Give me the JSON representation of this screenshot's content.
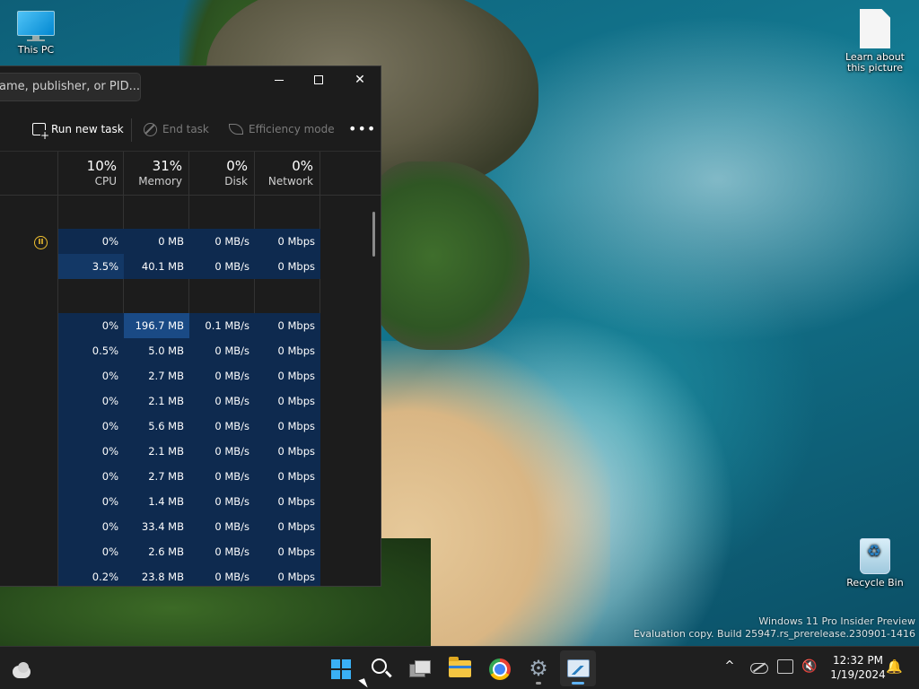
{
  "desktop": {
    "icons": [
      {
        "label": "This PC"
      },
      {
        "label": "Learn about this picture"
      },
      {
        "label": "Recycle Bin"
      }
    ],
    "watermark": {
      "line1": "Windows 11 Pro Insider Preview",
      "line2": "Evaluation copy. Build 25947.rs_prerelease.230901-1416"
    }
  },
  "task_manager": {
    "search_placeholder": "ame, publisher, or PID...",
    "toolbar": {
      "run_new_task": "Run new task",
      "end_task": "End task",
      "efficiency_mode": "Efficiency mode",
      "more": "•••"
    },
    "columns": [
      {
        "pct": "10%",
        "label": "CPU"
      },
      {
        "pct": "31%",
        "label": "Memory"
      },
      {
        "pct": "0%",
        "label": "Disk"
      },
      {
        "pct": "0%",
        "label": "Network"
      }
    ],
    "rows": [
      {
        "cpu": "0%",
        "mem": "0 MB",
        "disk": "0 MB/s",
        "net": "0 Mbps"
      },
      {
        "cpu": "3.5%",
        "mem": "40.1 MB",
        "disk": "0 MB/s",
        "net": "0 Mbps"
      },
      {
        "cpu": "0%",
        "mem": "196.7 MB",
        "disk": "0.1 MB/s",
        "net": "0 Mbps"
      },
      {
        "cpu": "0.5%",
        "mem": "5.0 MB",
        "disk": "0 MB/s",
        "net": "0 Mbps"
      },
      {
        "cpu": "0%",
        "mem": "2.7 MB",
        "disk": "0 MB/s",
        "net": "0 Mbps"
      },
      {
        "cpu": "0%",
        "mem": "2.1 MB",
        "disk": "0 MB/s",
        "net": "0 Mbps"
      },
      {
        "cpu": "0%",
        "mem": "5.6 MB",
        "disk": "0 MB/s",
        "net": "0 Mbps"
      },
      {
        "cpu": "0%",
        "mem": "2.1 MB",
        "disk": "0 MB/s",
        "net": "0 Mbps"
      },
      {
        "cpu": "0%",
        "mem": "2.7 MB",
        "disk": "0 MB/s",
        "net": "0 Mbps"
      },
      {
        "cpu": "0%",
        "mem": "1.4 MB",
        "disk": "0 MB/s",
        "net": "0 Mbps"
      },
      {
        "cpu": "0%",
        "mem": "33.4 MB",
        "disk": "0 MB/s",
        "net": "0 Mbps"
      },
      {
        "cpu": "0%",
        "mem": "2.6 MB",
        "disk": "0 MB/s",
        "net": "0 Mbps"
      },
      {
        "cpu": "0.2%",
        "mem": "23.8 MB",
        "disk": "0 MB/s",
        "net": "0 Mbps"
      }
    ],
    "colors": {
      "window_bg": "#1c1c1c",
      "heat_low": "#0e2a4f",
      "heat_mid": "#133866",
      "heat_high": "#1a4a85"
    }
  },
  "taskbar": {
    "time": "12:32 PM",
    "date": "1/19/2024",
    "apps": [
      "widgets",
      "start",
      "search",
      "task-view",
      "file-explorer",
      "chrome",
      "settings",
      "task-manager"
    ],
    "chevron": "^",
    "notifications": "🔔"
  }
}
